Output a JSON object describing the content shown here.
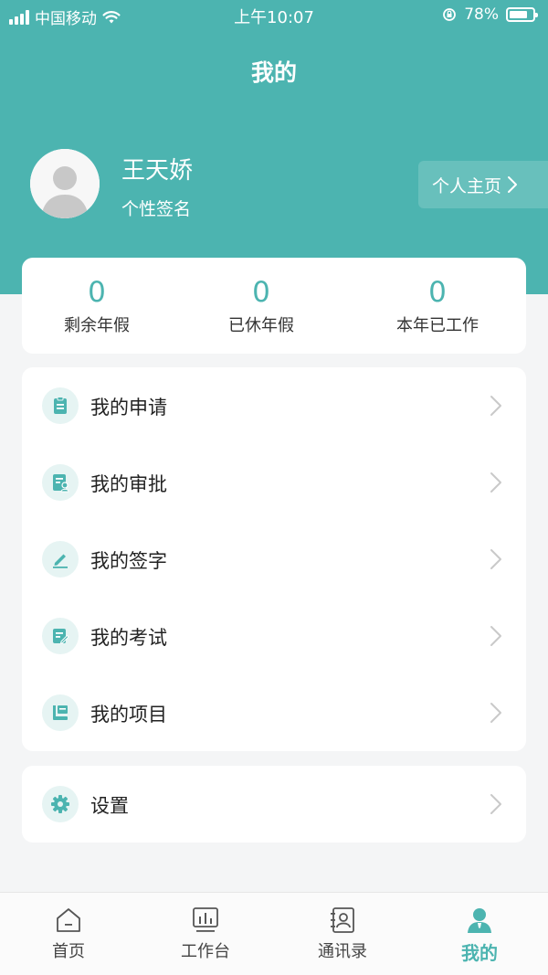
{
  "status_bar": {
    "carrier": "中国移动",
    "time": "上午10:07",
    "battery": "78%",
    "battery_level": 0.78
  },
  "nav": {
    "title": "我的"
  },
  "profile": {
    "name": "王天娇",
    "signature": "个性签名",
    "homepage_label": "个人主页"
  },
  "stats": [
    {
      "value": "0",
      "label": "剩余年假"
    },
    {
      "value": "0",
      "label": "已休年假"
    },
    {
      "value": "0",
      "label": "本年已工作"
    }
  ],
  "menu": [
    {
      "label": "我的申请",
      "icon": "clipboard-icon"
    },
    {
      "label": "我的审批",
      "icon": "approval-icon"
    },
    {
      "label": "我的签字",
      "icon": "pen-icon"
    },
    {
      "label": "我的考试",
      "icon": "exam-icon"
    },
    {
      "label": "我的项目",
      "icon": "project-icon"
    }
  ],
  "settings": {
    "label": "设置",
    "icon": "gear-icon"
  },
  "tabs": [
    {
      "label": "首页",
      "icon": "home-icon",
      "active": false
    },
    {
      "label": "工作台",
      "icon": "workbench-icon",
      "active": false
    },
    {
      "label": "通讯录",
      "icon": "contacts-icon",
      "active": false
    },
    {
      "label": "我的",
      "icon": "person-icon",
      "active": true
    }
  ],
  "colors": {
    "accent": "#4cb4b0",
    "icon_bg": "#e6f4f3",
    "background": "#f4f5f6"
  }
}
